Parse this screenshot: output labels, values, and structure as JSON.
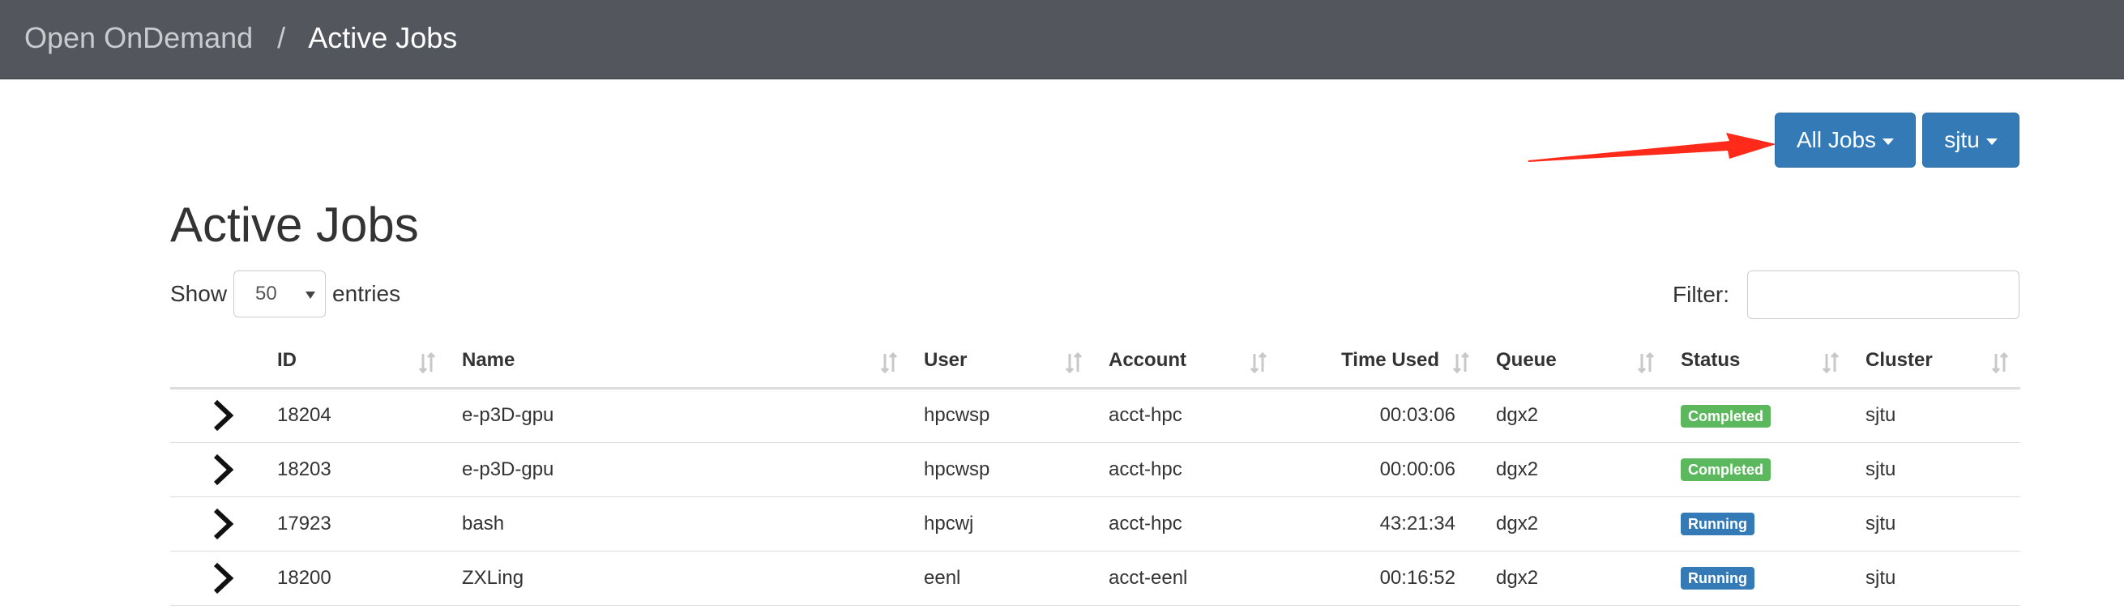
{
  "navbar": {
    "home": "Open OnDemand",
    "separator": "/",
    "current": "Active Jobs"
  },
  "filters": {
    "jobs_filter_label": "All Jobs",
    "cluster_filter_label": "sjtu"
  },
  "page": {
    "title": "Active Jobs"
  },
  "length_control": {
    "show_label": "Show",
    "selected": "50",
    "entries_label": "entries"
  },
  "search": {
    "label": "Filter:",
    "value": ""
  },
  "table": {
    "columns": [
      "ID",
      "Name",
      "User",
      "Account",
      "Time Used",
      "Queue",
      "Status",
      "Cluster"
    ],
    "rows": [
      {
        "id": "18204",
        "name": "e-p3D-gpu",
        "user": "hpcwsp",
        "account": "acct-hpc",
        "time_used": "00:03:06",
        "queue": "dgx2",
        "status": "Completed",
        "cluster": "sjtu"
      },
      {
        "id": "18203",
        "name": "e-p3D-gpu",
        "user": "hpcwsp",
        "account": "acct-hpc",
        "time_used": "00:00:06",
        "queue": "dgx2",
        "status": "Completed",
        "cluster": "sjtu"
      },
      {
        "id": "17923",
        "name": "bash",
        "user": "hpcwj",
        "account": "acct-hpc",
        "time_used": "43:21:34",
        "queue": "dgx2",
        "status": "Running",
        "cluster": "sjtu"
      },
      {
        "id": "18200",
        "name": "ZXLing",
        "user": "eenl",
        "account": "acct-eenl",
        "time_used": "00:16:52",
        "queue": "dgx2",
        "status": "Running",
        "cluster": "sjtu"
      }
    ]
  },
  "colors": {
    "navbar": "#53575d",
    "primary": "#337ab7",
    "success": "#5cb85c",
    "annotation_arrow": "#ff2a1a"
  }
}
